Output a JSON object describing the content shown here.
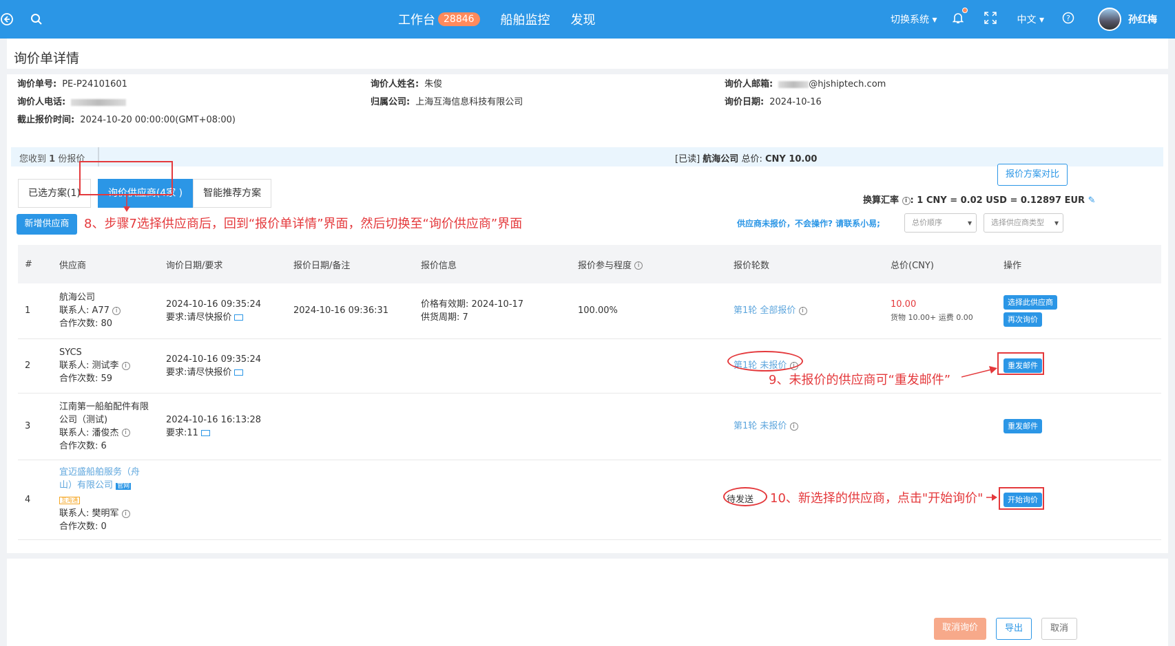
{
  "topbar": {
    "workbench": "工作台",
    "workbench_count": "28846",
    "ship_monitor": "船舶监控",
    "discover": "发现",
    "switch_system": "切换系统",
    "lang": "中文",
    "user": "孙红梅"
  },
  "page_title": "询价单详情",
  "info": {
    "no_label": "询价单号:",
    "no_value": "PE-P24101601",
    "name_label": "询价人姓名:",
    "name_value": "朱俊",
    "email_label": "询价人邮箱:",
    "email_value": "@hjshiptech.com",
    "phone_label": "询价人电话:",
    "company_label": "归属公司:",
    "company_value": "上海互海信息科技有限公司",
    "date_label": "询价日期:",
    "date_value": "2024-10-16",
    "deadline_label": "截止报价时间:",
    "deadline_value": "2024-10-20 00:00:00(GMT+08:00)"
  },
  "quote_bar": {
    "received_prefix": "您收到",
    "received_count": "1",
    "received_suffix": "份报价",
    "read_tag": "[已读]",
    "supplier": "航海公司",
    "total_label": "总价:",
    "total_value": "CNY 10.00"
  },
  "tabs": [
    "已选方案(1)",
    "询价供应商(4家 )",
    "智能推荐方案"
  ],
  "compare_button": "报价方案对比",
  "exchange": {
    "label": "换算汇率",
    "value": "1 CNY = 0.02 USD = 0.12897 EUR"
  },
  "add_supplier": "新增供应商",
  "help_text": "供应商未报价，不会操作? 请联系小易;",
  "sort_select": "总价顺序",
  "type_select": "选择供应商类型",
  "columns": [
    "#",
    "供应商",
    "询价日期/要求",
    "报价日期/备注",
    "报价信息",
    "报价参与程度",
    "报价轮数",
    "总价(CNY)",
    "操作"
  ],
  "rows": [
    {
      "idx": "1",
      "supplier": "航海公司",
      "contact": "联系人:  A77",
      "coop": "合作次数:  80",
      "inq_date": "2024-10-16 09:35:24",
      "req": "要求:请尽快报价",
      "quote_date": "2024-10-16 09:36:31",
      "validity": "价格有效期: 2024-10-17",
      "supply": "供货周期:   7",
      "participation": "100.00%",
      "round": "第1轮 全部报价",
      "total": "10.00",
      "total_detail": "货物 10.00+ 运费 0.00",
      "btn1": "选择此供应商",
      "btn2": "再次询价"
    },
    {
      "idx": "2",
      "supplier": "SYCS",
      "contact": "联系人:  测试李",
      "coop": "合作次数:  59",
      "inq_date": "2024-10-16 09:35:24",
      "req": "要求:请尽快报价",
      "round": "第1轮 未报价",
      "btn1": "重发邮件"
    },
    {
      "idx": "3",
      "supplier": "江南第一船舶配件有限公司（测试)",
      "contact": "联系人:  潘俊杰",
      "coop": "合作次数:  6",
      "inq_date": "2024-10-16 16:13:28",
      "req": "要求:11",
      "round": "第1轮 未报价",
      "btn1": "重发邮件"
    },
    {
      "idx": "4",
      "supplier": "宜迈盛船舶服务（舟山）有限公司",
      "tag1": "官网",
      "tag2": "互海通",
      "contact": "联系人:  樊明军",
      "coop": "合作次数:  0",
      "round": "待发送",
      "btn1": "开始询价"
    }
  ],
  "annotations": {
    "a8": "8、步骤7选择供应商后，回到“报价单详情”界面，然后切换至“询价供应商”界面",
    "a9": "9、未报价的供应商可“重发邮件”",
    "a10": "10、新选择的供应商，点击\"开始询价\""
  },
  "footer": {
    "cancel": "取消询价",
    "export": "导出",
    "close": "取消"
  }
}
